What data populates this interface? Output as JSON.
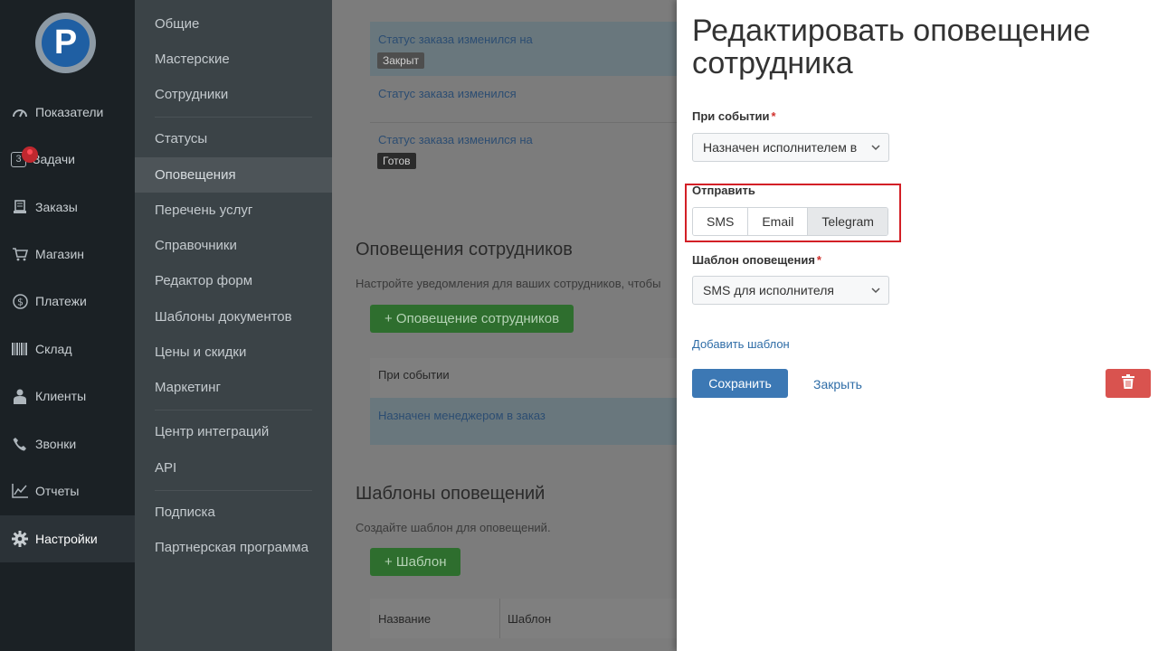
{
  "sidebar": {
    "logo_glyph": "P",
    "items": [
      {
        "label": "Показатели",
        "icon": "gauge-icon"
      },
      {
        "label": "Задачи",
        "icon": "tasks-icon",
        "count": "3"
      },
      {
        "label": "Заказы",
        "icon": "orders-icon"
      },
      {
        "label": "Магазин",
        "icon": "cart-icon"
      },
      {
        "label": "Платежи",
        "icon": "dollar-icon"
      },
      {
        "label": "Склад",
        "icon": "barcode-icon"
      },
      {
        "label": "Клиенты",
        "icon": "user-icon"
      },
      {
        "label": "Звонки",
        "icon": "phone-icon"
      },
      {
        "label": "Отчеты",
        "icon": "chart-icon"
      },
      {
        "label": "Настройки",
        "icon": "gear-icon",
        "active": true
      }
    ]
  },
  "submenu": {
    "items": [
      "Общие",
      "Мастерские",
      "Сотрудники",
      "Статусы",
      "Оповещения",
      "Перечень услуг",
      "Справочники",
      "Редактор форм",
      "Шаблоны документов",
      "Цены и скидки",
      "Маркетинг",
      "Центр интеграций",
      "API",
      "Подписка",
      "Партнерская программа"
    ],
    "active": "Оповещения"
  },
  "main": {
    "status_rows": [
      {
        "text": "Статус заказа изменился на",
        "tag": "Закрыт"
      },
      {
        "text": "Статус заказа изменился",
        "tag": ""
      },
      {
        "text": "Статус заказа изменился на",
        "tag": "Готов"
      }
    ],
    "employee_section": {
      "title": "Оповещения сотрудников",
      "desc": "Настройте уведомления для ваших сотрудников, чтобы",
      "add_button": "+ Оповещение сотрудников",
      "table_header": "При событии",
      "row": "Назначен менеджером в заказ"
    },
    "templates_section": {
      "title": "Шаблоны оповещений",
      "desc": "Создайте шаблон для оповещений.",
      "add_button": "+ Шаблон",
      "col_name": "Название",
      "col_template": "Шаблон"
    }
  },
  "panel": {
    "title": "Редактировать оповещение сотрудника",
    "event_label": "При событии",
    "event_value": "Назначен исполнителем в",
    "send_label": "Отправить",
    "send_options": [
      "SMS",
      "Email",
      "Telegram"
    ],
    "send_selected": "Telegram",
    "template_label": "Шаблон оповещения",
    "template_value": "SMS для исполнителя",
    "add_template_link": "Добавить шаблон",
    "save_button": "Сохранить",
    "close_link": "Закрыть"
  },
  "colors": {
    "accent_blue": "#3c78b4",
    "danger_red": "#d9534f",
    "highlight_outline": "#d31f26",
    "sidebar_bg": "#1b2125"
  }
}
